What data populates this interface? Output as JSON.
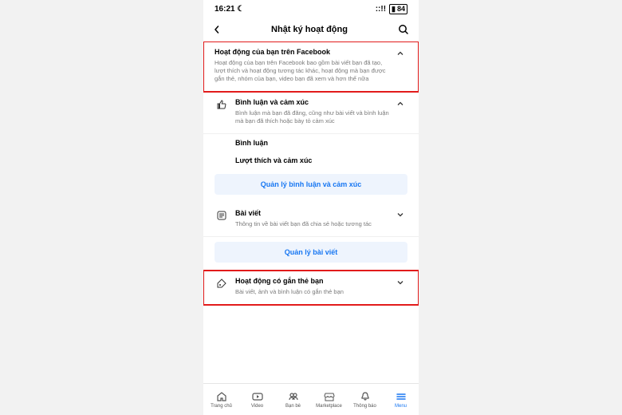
{
  "status": {
    "time": "16:21",
    "moon": "☾",
    "signal": "::!!",
    "wifi": "⏚",
    "battery": "84"
  },
  "header": {
    "title": "Nhật ký hoạt động"
  },
  "s1": {
    "title": "Hoạt động của bạn trên Facebook",
    "desc": "Hoạt động của bạn trên Facebook bao gồm bài viết bạn đã tạo, lượt thích và hoạt động tương tác khác, hoạt động mà bạn được gắn thẻ, nhóm của bạn, video bạn đã xem và hơn thế nữa"
  },
  "s2": {
    "title": "Bình luận và cảm xúc",
    "desc": "Bình luận mà bạn đã đăng, cũng như bài viết và bình luận mà bạn đã thích hoặc bày tỏ cảm xúc",
    "sub1": "Bình luận",
    "sub2": "Lượt thích và cảm xúc",
    "manage": "Quản lý bình luận và cảm xúc"
  },
  "s3": {
    "title": "Bài viết",
    "desc": "Thông tin về bài viết bạn đã chia sẻ hoặc tương tác",
    "manage": "Quản lý bài viết"
  },
  "s4": {
    "title": "Hoạt động có gắn thẻ bạn",
    "desc": "Bài viết, ảnh và bình luận có gắn thẻ bạn"
  },
  "tabs": {
    "home": "Trang chủ",
    "video": "Video",
    "friends": "Bạn bè",
    "market": "Marketplace",
    "notif": "Thông báo",
    "menu": "Menu"
  }
}
